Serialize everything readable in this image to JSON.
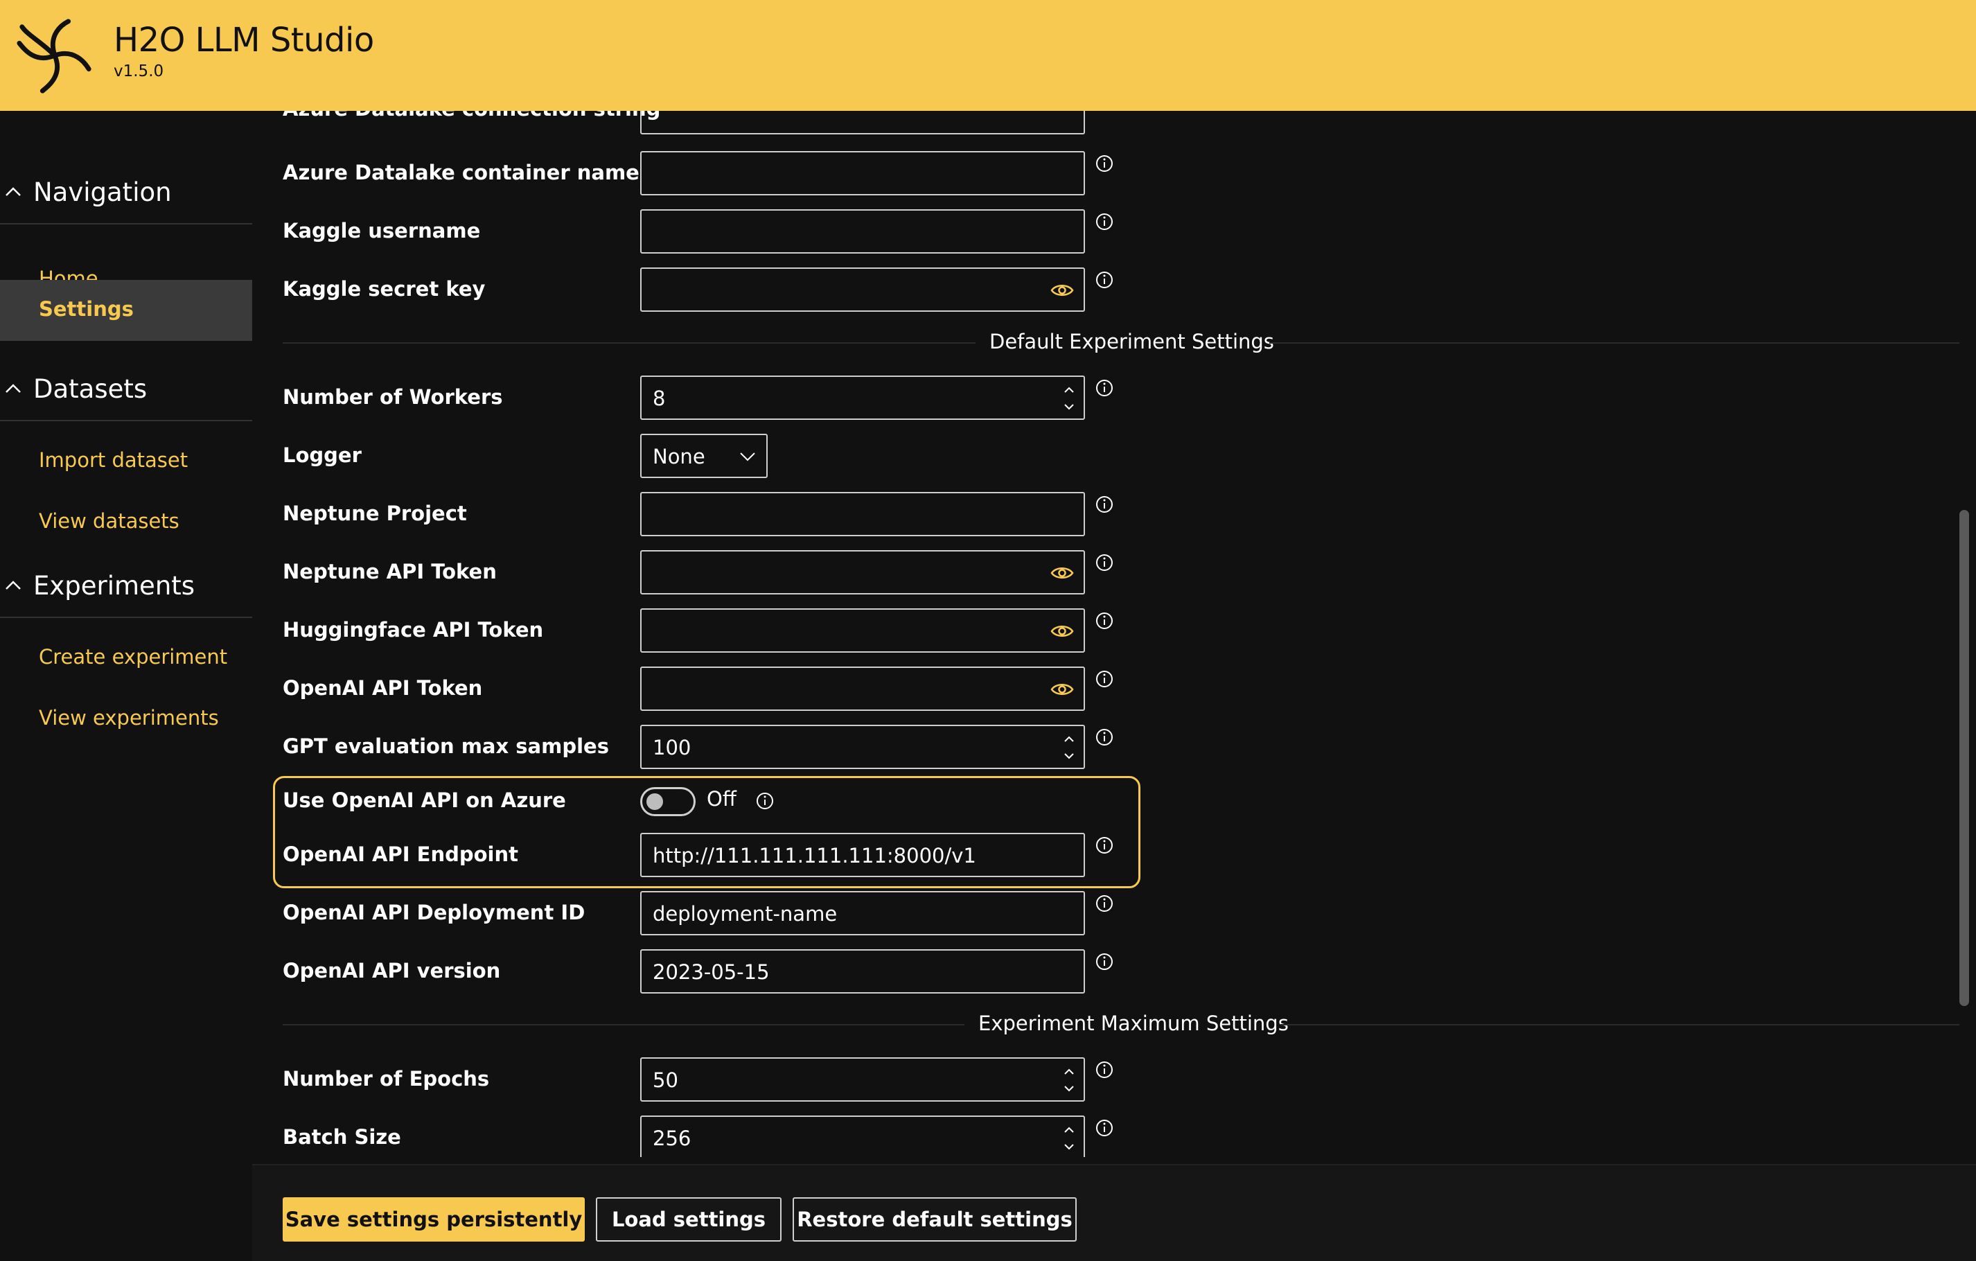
{
  "app": {
    "title": "H2O LLM Studio",
    "version": "v1.5.0"
  },
  "sidebar": {
    "groups": [
      {
        "label": "Navigation",
        "items": [
          {
            "label": "Home"
          },
          {
            "label": "Settings"
          }
        ]
      },
      {
        "label": "Datasets",
        "items": [
          {
            "label": "Import dataset"
          },
          {
            "label": "View datasets"
          }
        ]
      },
      {
        "label": "Experiments",
        "items": [
          {
            "label": "Create experiment"
          },
          {
            "label": "View experiments"
          }
        ]
      }
    ],
    "active_item": "Settings"
  },
  "settings": {
    "partial_label": "Azure Datalake connection string",
    "azure_container": {
      "label": "Azure Datalake container name",
      "value": ""
    },
    "kaggle_username": {
      "label": "Kaggle username",
      "value": ""
    },
    "kaggle_secret": {
      "label": "Kaggle secret key",
      "value": ""
    },
    "section_default": "Default Experiment Settings",
    "num_workers": {
      "label": "Number of Workers",
      "value": "8"
    },
    "logger": {
      "label": "Logger",
      "value": "None"
    },
    "neptune_project": {
      "label": "Neptune Project",
      "value": ""
    },
    "neptune_token": {
      "label": "Neptune API Token",
      "value": ""
    },
    "hf_token": {
      "label": "Huggingface API Token",
      "value": ""
    },
    "openai_token": {
      "label": "OpenAI API Token",
      "value": ""
    },
    "gpt_max_samples": {
      "label": "GPT evaluation max samples",
      "value": "100"
    },
    "use_azure": {
      "label": "Use OpenAI API on Azure",
      "state": "Off"
    },
    "openai_endpoint": {
      "label": "OpenAI API Endpoint",
      "value": "http://111.111.111.111:8000/v1"
    },
    "openai_deployment": {
      "label": "OpenAI API Deployment ID",
      "value": "deployment-name"
    },
    "openai_version": {
      "label": "OpenAI API version",
      "value": "2023-05-15"
    },
    "section_max": "Experiment Maximum Settings",
    "num_epochs": {
      "label": "Number of Epochs",
      "value": "50"
    },
    "batch_size": {
      "label": "Batch Size",
      "value": "256"
    }
  },
  "footer": {
    "save": "Save settings persistently",
    "load": "Load settings",
    "restore": "Restore default settings"
  },
  "colors": {
    "accent": "#f8c950",
    "background": "#111111",
    "active_nav": "#3a3a3a"
  },
  "icons": {
    "logo": "h2o-logo-icon",
    "info": "info-icon",
    "reveal": "eye-icon",
    "collapse": "chevron-up-icon"
  }
}
